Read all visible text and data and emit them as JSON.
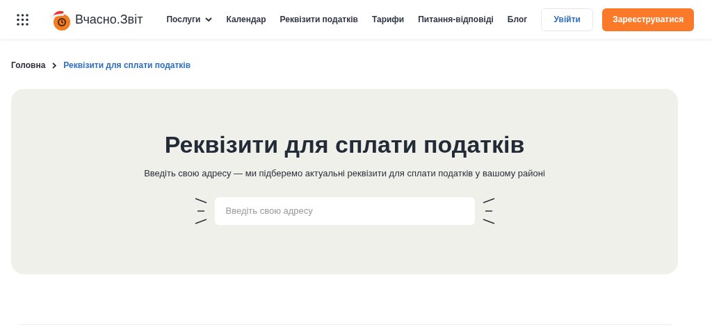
{
  "header": {
    "logo_text": "Вчасно.Звіт",
    "nav": [
      {
        "label": "Послуги",
        "has_dropdown": true
      },
      {
        "label": "Календар",
        "has_dropdown": false
      },
      {
        "label": "Реквізити податків",
        "has_dropdown": false
      },
      {
        "label": "Тарифи",
        "has_dropdown": false
      },
      {
        "label": "Питання-відповіді",
        "has_dropdown": false
      },
      {
        "label": "Блог",
        "has_dropdown": false
      }
    ],
    "login_button": "Увійти",
    "register_button": "Зареєструватися"
  },
  "breadcrumb": [
    {
      "label": "Головна",
      "current": false
    },
    {
      "label": "Реквізити для сплати податків",
      "current": true
    }
  ],
  "hero": {
    "title": "Реквізити для сплати податків",
    "subtitle": "Введіть свою адресу — ми підберемо актуальні реквізити для сплати податків у вашому районі",
    "search": {
      "placeholder": "Введіть свою адресу"
    }
  }
}
